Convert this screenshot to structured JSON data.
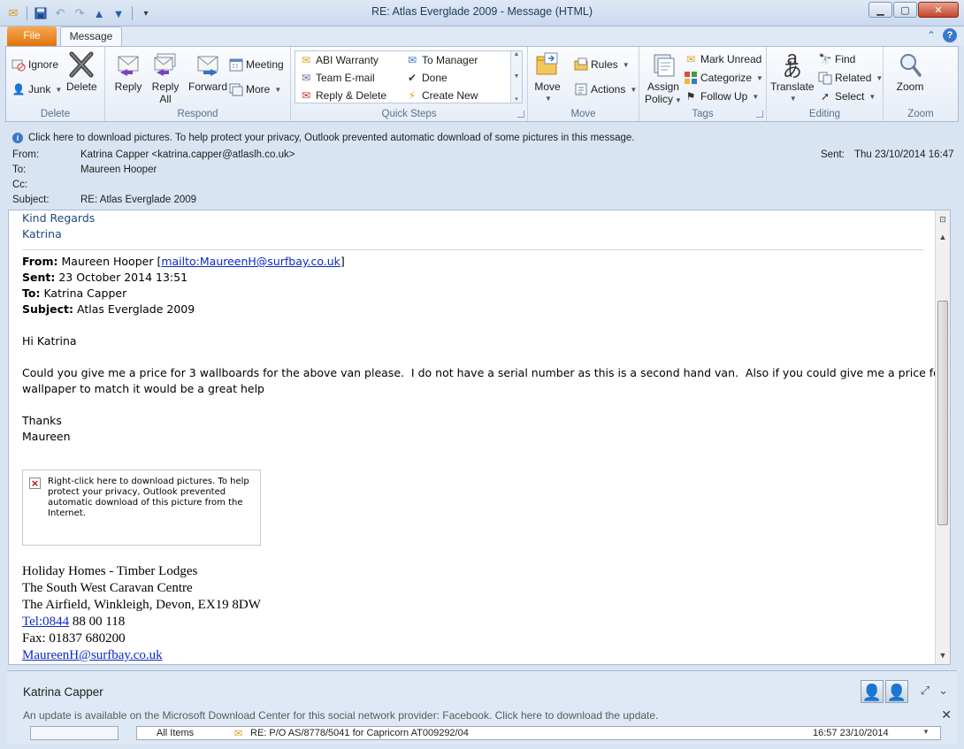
{
  "window": {
    "title": "RE: Atlas Everglade 2009  -  Message (HTML)",
    "qat_icons": [
      "mail-icon",
      "save-icon",
      "undo-icon",
      "redo-icon",
      "up-arrow-icon",
      "down-arrow-icon",
      "customize-icon"
    ]
  },
  "tabs": {
    "file": "File",
    "message": "Message"
  },
  "ribbon": {
    "delete": {
      "label": "Delete",
      "ignore": "Ignore",
      "junk": "Junk",
      "delete_btn": "Delete"
    },
    "respond": {
      "label": "Respond",
      "reply": "Reply",
      "reply_all_1": "Reply",
      "reply_all_2": "All",
      "forward": "Forward",
      "meeting": "Meeting",
      "more": "More"
    },
    "quick_steps": {
      "label": "Quick Steps",
      "items": [
        "ABI Warranty",
        "To Manager",
        "Team E-mail",
        "Done",
        "Reply & Delete",
        "Create New"
      ]
    },
    "move": {
      "label": "Move",
      "move_btn": "Move",
      "rules": "Rules",
      "actions": "Actions"
    },
    "tags": {
      "label": "Tags",
      "assign_1": "Assign",
      "assign_2": "Policy",
      "mark_unread": "Mark Unread",
      "categorize": "Categorize",
      "follow_up": "Follow Up"
    },
    "editing": {
      "label": "Editing",
      "translate": "Translate",
      "find": "Find",
      "related": "Related",
      "select": "Select"
    },
    "zoom": {
      "label": "Zoom",
      "zoom_btn": "Zoom"
    }
  },
  "infobar": "Click here to download pictures. To help protect your privacy, Outlook prevented automatic download of some pictures in this message.",
  "header": {
    "from_label": "From:",
    "from_value": "Katrina Capper <katrina.capper@atlaslh.co.uk>",
    "to_label": "To:",
    "to_value": "Maureen Hooper",
    "cc_label": "Cc:",
    "subject_label": "Subject:",
    "subject_value": "RE: Atlas Everglade 2009",
    "sent_label": "Sent:",
    "sent_value": "Thu 23/10/2014 16:47"
  },
  "body": {
    "kind_regards": "Kind Regards",
    "signoff_name": "Katrina",
    "orig_from_label": "From:",
    "orig_from_name": "Maureen Hooper [",
    "orig_from_link": "mailto:MaureenH@surfbay.co.uk",
    "orig_from_end": "]",
    "orig_sent_label": "Sent:",
    "orig_sent_value": "23 October 2014 13:51",
    "orig_to_label": "To:",
    "orig_to_value": "Katrina Capper",
    "orig_subject_label": "Subject:",
    "orig_subject_value": "Atlas Everglade 2009",
    "greeting": "Hi Katrina",
    "message_line1": "Could you give me a price for 3 wallboards for the above van please.  I do not have a serial number as this is a second hand van.  Also if you could give me a price for",
    "message_line2": "wallpaper to match it would be a great help",
    "thanks": "Thanks",
    "name": "Maureen",
    "blocked_image_text": "Right-click here to download pictures.  To help protect your privacy, Outlook prevented automatic download of this picture from the Internet.",
    "sig_line1": "Holiday Homes - Timber Lodges",
    "sig_line2": "The South West Caravan Centre",
    "sig_line3": "The Airfield, Winkleigh, Devon, EX19 8DW",
    "sig_tel_link": "Tel:0844",
    "sig_tel_rest": " 88 00 118",
    "sig_fax": "Fax: 01837 680200",
    "sig_email_partial": "MaureenH@surfbay.co.uk"
  },
  "people_pane": {
    "name": "Katrina Capper",
    "update_message": "An update is available on the Microsoft Download Center for this social network provider: Facebook. Click here to download the update.",
    "list_filter": "All Items",
    "list_item_subject": "RE: P/O AS/8778/5041 for Capricorn AT009292/04",
    "list_item_time": "16:57  23/10/2014"
  }
}
